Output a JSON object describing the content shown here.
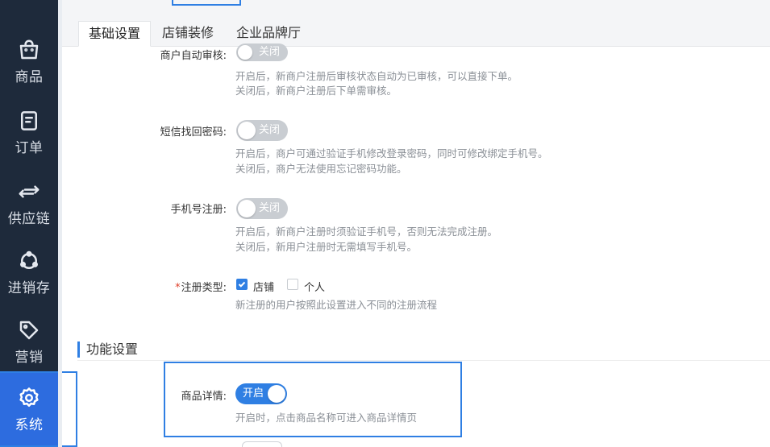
{
  "sidebar": {
    "items": [
      {
        "label": "商品",
        "icon": "shopping-bag-icon"
      },
      {
        "label": "订单",
        "icon": "order-list-icon"
      },
      {
        "label": "供应链",
        "icon": "swap-arrows-icon"
      },
      {
        "label": "进销存",
        "icon": "network-nodes-icon"
      },
      {
        "label": "营销",
        "icon": "price-tag-icon"
      },
      {
        "label": "系统",
        "icon": "gear-icon",
        "active": true
      }
    ]
  },
  "tabs": [
    {
      "label": "基础设置",
      "active": true
    },
    {
      "label": "店铺装修"
    },
    {
      "label": "企业品牌厅"
    }
  ],
  "settings": {
    "auto_review": {
      "label": "商户自动审核:",
      "toggle": "关闭",
      "help1": "开启后，新商户注册后审核状态自动为已审核，可以直接下单。",
      "help2": "关闭后，新商户注册后下单需审核。"
    },
    "sms_recover": {
      "label": "短信找回密码:",
      "toggle": "关闭",
      "help1": "开启后，商户可通过验证手机修改登录密码，同时可修改绑定手机号。",
      "help2": "关闭后，商户无法使用忘记密码功能。"
    },
    "phone_register": {
      "label": "手机号注册:",
      "toggle": "关闭",
      "help1": "开启后，新商户注册时须验证手机号，否则无法完成注册。",
      "help2": "关闭后，新用户注册时无需填写手机号。"
    },
    "register_type": {
      "required_mark": "*",
      "label": "注册类型:",
      "options": [
        {
          "label": "店铺",
          "checked": true
        },
        {
          "label": "个人",
          "checked": false
        }
      ],
      "help": "新注册的用户按照此设置进入不同的注册流程"
    }
  },
  "function_section": {
    "title": "功能设置",
    "product_detail": {
      "label": "商品详情:",
      "toggle": "开启",
      "help": "开启时，点击商品名称可进入商品详情页"
    }
  },
  "colors": {
    "sidebar_bg": "#1e2a3b",
    "accent": "#2f7fe3",
    "toggle_off": "#c9cdd2",
    "help_text": "#8a8f96",
    "required": "#e0412b"
  }
}
